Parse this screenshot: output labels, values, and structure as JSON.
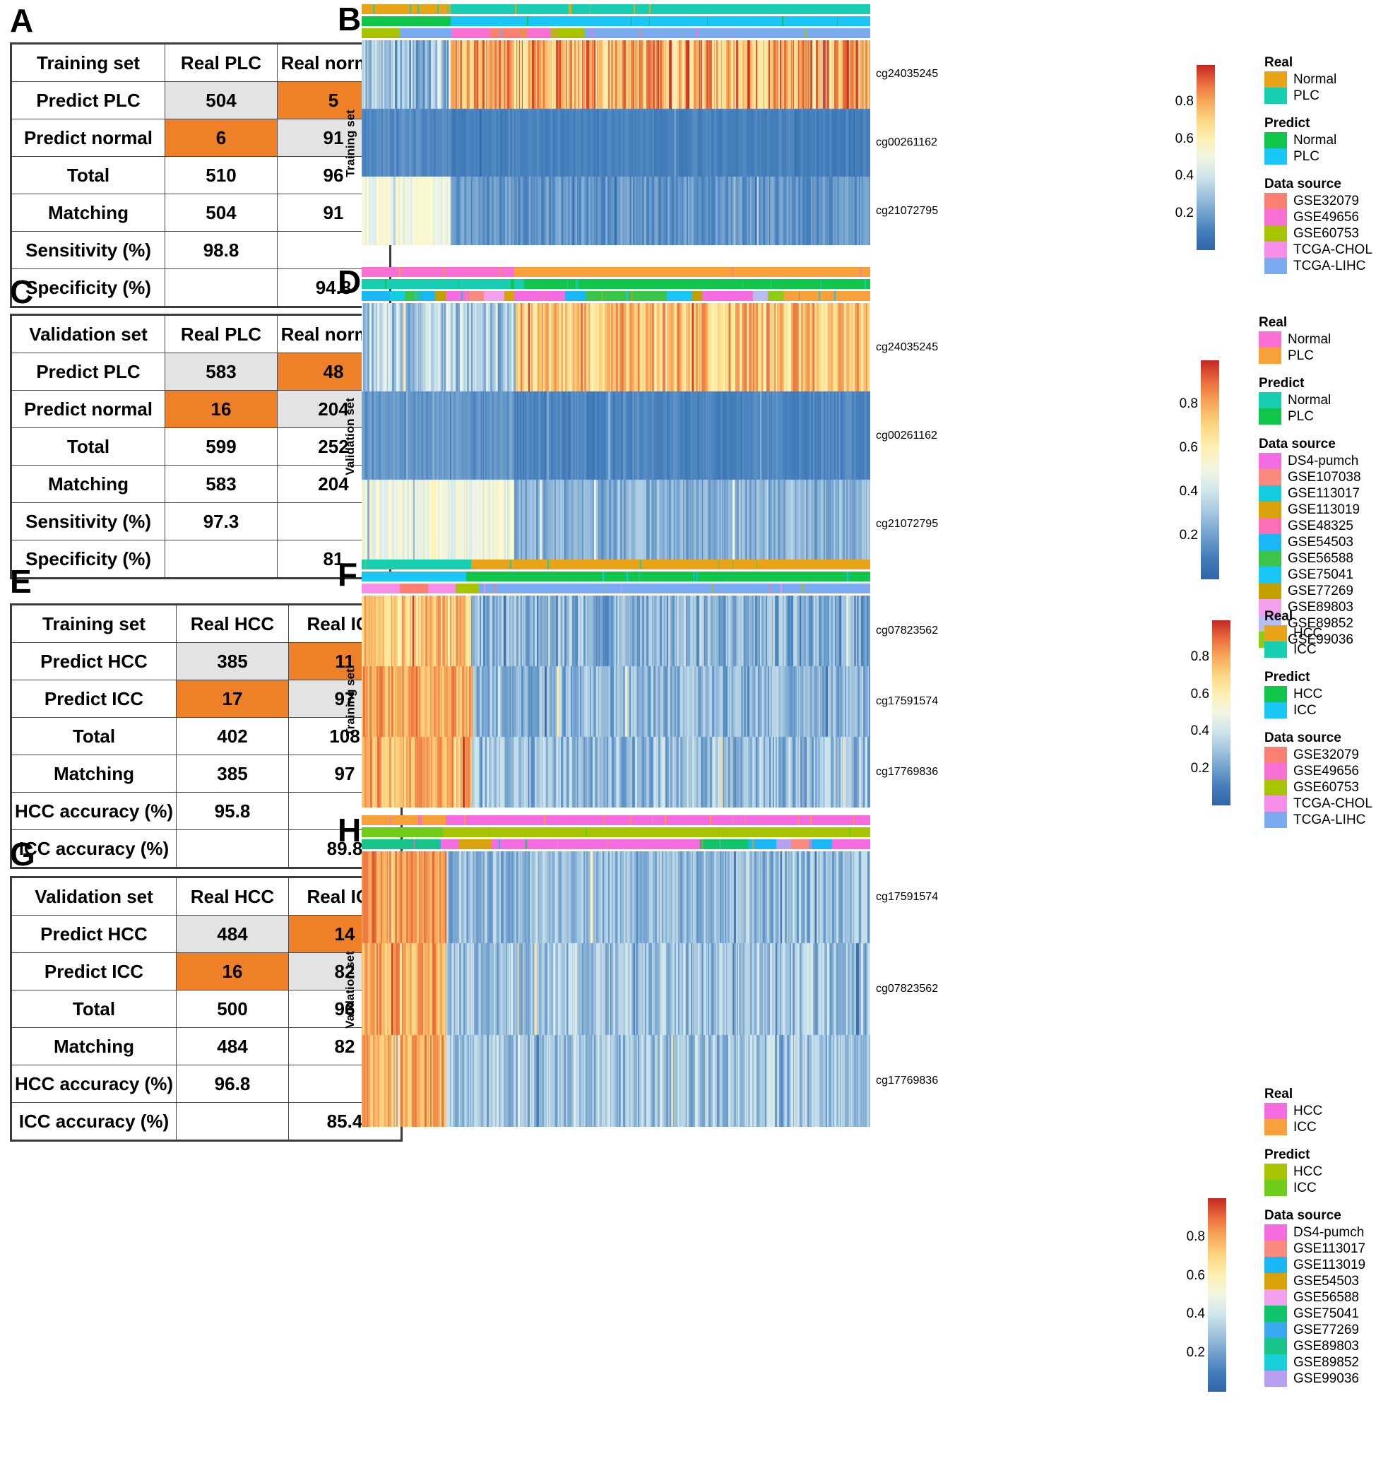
{
  "figure": {
    "panels": [
      "A",
      "B",
      "C",
      "D",
      "E",
      "F",
      "G",
      "H"
    ]
  },
  "palette": {
    "orange_cell": "#ee8027",
    "grey_cell": "#e3e3e3",
    "heat_high": "#cb2b1f",
    "heat_mid": "#fffacd",
    "heat_low": "#3a6fae"
  },
  "panelA": {
    "letter": "A",
    "headers": [
      "Training set",
      "Real PLC",
      "Real normal"
    ],
    "rows": [
      {
        "label": "Predict PLC",
        "c1": "504",
        "c2": "5",
        "c1style": "grey",
        "c2style": "orange"
      },
      {
        "label": "Predict normal",
        "c1": "6",
        "c2": "91",
        "c1style": "orange",
        "c2style": "grey"
      },
      {
        "label": "Total",
        "c1": "510",
        "c2": "96",
        "c1style": "plain",
        "c2style": "plain"
      },
      {
        "label": "Matching",
        "c1": "504",
        "c2": "91",
        "c1style": "plain",
        "c2style": "plain"
      },
      {
        "label": "Sensitivity (%)",
        "c1": "98.8",
        "c2": "",
        "c1style": "plain",
        "c2style": "plain"
      },
      {
        "label": "Specificity (%)",
        "c1": "",
        "c2": "94.8",
        "c1style": "plain",
        "c2style": "plain"
      }
    ]
  },
  "panelC": {
    "letter": "C",
    "headers": [
      "Validation set",
      "Real PLC",
      "Real normal"
    ],
    "rows": [
      {
        "label": "Predict PLC",
        "c1": "583",
        "c2": "48",
        "c1style": "grey",
        "c2style": "orange"
      },
      {
        "label": "Predict normal",
        "c1": "16",
        "c2": "204",
        "c1style": "orange",
        "c2style": "grey"
      },
      {
        "label": "Total",
        "c1": "599",
        "c2": "252",
        "c1style": "plain",
        "c2style": "plain"
      },
      {
        "label": "Matching",
        "c1": "583",
        "c2": "204",
        "c1style": "plain",
        "c2style": "plain"
      },
      {
        "label": "Sensitivity (%)",
        "c1": "97.3",
        "c2": "",
        "c1style": "plain",
        "c2style": "plain"
      },
      {
        "label": "Specificity (%)",
        "c1": "",
        "c2": "81",
        "c1style": "plain",
        "c2style": "plain"
      }
    ]
  },
  "panelE": {
    "letter": "E",
    "headers": [
      "Training set",
      "Real HCC",
      "Real ICC"
    ],
    "rows": [
      {
        "label": "Predict HCC",
        "c1": "385",
        "c2": "11",
        "c1style": "grey",
        "c2style": "orange"
      },
      {
        "label": "Predict ICC",
        "c1": "17",
        "c2": "97",
        "c1style": "orange",
        "c2style": "grey"
      },
      {
        "label": "Total",
        "c1": "402",
        "c2": "108",
        "c1style": "plain",
        "c2style": "plain"
      },
      {
        "label": "Matching",
        "c1": "385",
        "c2": "97",
        "c1style": "plain",
        "c2style": "plain"
      },
      {
        "label": "HCC accuracy (%)",
        "c1": "95.8",
        "c2": "",
        "c1style": "plain",
        "c2style": "plain"
      },
      {
        "label": "ICC accuracy (%)",
        "c1": "",
        "c2": "89.8",
        "c1style": "plain",
        "c2style": "plain"
      }
    ]
  },
  "panelG": {
    "letter": "G",
    "headers": [
      "Validation set",
      "Real HCC",
      "Real ICC"
    ],
    "rows": [
      {
        "label": "Predict HCC",
        "c1": "484",
        "c2": "14",
        "c1style": "grey",
        "c2style": "orange"
      },
      {
        "label": "Predict ICC",
        "c1": "16",
        "c2": "82",
        "c1style": "orange",
        "c2style": "grey"
      },
      {
        "label": "Total",
        "c1": "500",
        "c2": "96",
        "c1style": "plain",
        "c2style": "plain"
      },
      {
        "label": "Matching",
        "c1": "484",
        "c2": "82",
        "c1style": "plain",
        "c2style": "plain"
      },
      {
        "label": "HCC accuracy (%)",
        "c1": "96.8",
        "c2": "",
        "c1style": "plain",
        "c2style": "plain"
      },
      {
        "label": "ICC accuracy (%)",
        "c1": "",
        "c2": "85.4",
        "c1style": "plain",
        "c2style": "plain"
      }
    ]
  },
  "chart_data": [
    {
      "id": "panelB",
      "letter": "B",
      "type": "heatmap",
      "title": "",
      "ylabel": "Training set",
      "row_labels": [
        "cg24035245",
        "cg00261162",
        "cg21072795"
      ],
      "annotation_tracks": [
        {
          "name": "Real",
          "label": "Real"
        },
        {
          "name": "Predict",
          "label": "Predict"
        },
        {
          "name": "Data source",
          "label": "Data source"
        }
      ],
      "colorbar": {
        "ticks": [
          "0.8",
          "0.6",
          "0.4",
          "0.2"
        ],
        "values": [
          0.8,
          0.6,
          0.4,
          0.2
        ],
        "min": 0,
        "max": 1
      },
      "legends": [
        {
          "title": "Real",
          "items": [
            {
              "label": "Normal",
              "color": "#e8a317"
            },
            {
              "label": "PLC",
              "color": "#17cfb0"
            }
          ]
        },
        {
          "title": "Predict",
          "items": [
            {
              "label": "Normal",
              "color": "#0fc64a"
            },
            {
              "label": "PLC",
              "color": "#19c6f5"
            }
          ]
        },
        {
          "title": "Data source",
          "items": [
            {
              "label": "GSE32079",
              "color": "#fa8072"
            },
            {
              "label": "GSE49656",
              "color": "#fa6fd3"
            },
            {
              "label": "GSE60753",
              "color": "#a8c400"
            },
            {
              "label": "TCGA-CHOL",
              "color": "#f58fe8"
            },
            {
              "label": "TCGA-LIHC",
              "color": "#7aaaf0"
            }
          ]
        }
      ],
      "track_segments": {
        "Real": [
          [
            "#e8a317",
            0.175
          ],
          [
            "#17cfb0",
            0.825
          ]
        ],
        "Predict": [
          [
            "#0fc64a",
            0.175
          ],
          [
            "#19c6f5",
            0.825
          ]
        ],
        "Data source": [
          [
            "#a8c400",
            0.075
          ],
          [
            "#7aaaf0",
            0.102
          ],
          [
            "#fa6fd3",
            0.075
          ],
          [
            "#fa8072",
            0.075
          ],
          [
            "#fa6fd3",
            0.045
          ],
          [
            "#a8c400",
            0.065
          ],
          [
            "#7aaaf0",
            0.563
          ]
        ]
      },
      "row_profiles": [
        {
          "cpg": "cg24035245",
          "left_mean": 0.3,
          "right_mean": 0.78,
          "split": 0.175,
          "noise": 0.2
        },
        {
          "cpg": "cg00261162",
          "left_mean": 0.14,
          "right_mean": 0.11,
          "split": 0.175,
          "noise": 0.04
        },
        {
          "cpg": "cg21072795",
          "left_mean": 0.5,
          "right_mean": 0.17,
          "split": 0.175,
          "noise": 0.08
        }
      ]
    },
    {
      "id": "panelD",
      "letter": "D",
      "type": "heatmap",
      "title": "",
      "ylabel": "Validation set",
      "row_labels": [
        "cg24035245",
        "cg00261162",
        "cg21072795"
      ],
      "annotation_tracks": [
        {
          "name": "Real",
          "label": "Real"
        },
        {
          "name": "Predict",
          "label": "Predict"
        },
        {
          "name": "Data source",
          "label": "Data source"
        }
      ],
      "colorbar": {
        "ticks": [
          "0.8",
          "0.6",
          "0.4",
          "0.2"
        ],
        "values": [
          0.8,
          0.6,
          0.4,
          0.2
        ],
        "min": 0,
        "max": 1
      },
      "legends": [
        {
          "title": "Real",
          "items": [
            {
              "label": "Normal",
              "color": "#fa6fd3"
            },
            {
              "label": "PLC",
              "color": "#f8a03a"
            }
          ]
        },
        {
          "title": "Predict",
          "items": [
            {
              "label": "Normal",
              "color": "#17cfb0"
            },
            {
              "label": "PLC",
              "color": "#0fc64a"
            }
          ]
        },
        {
          "title": "Data source",
          "items": [
            {
              "label": "DS4-pumch",
              "color": "#f56ce0"
            },
            {
              "label": "GSE107038",
              "color": "#fa8a80"
            },
            {
              "label": "GSE113017",
              "color": "#14cde2"
            },
            {
              "label": "GSE113019",
              "color": "#d9a20a"
            },
            {
              "label": "GSE48325",
              "color": "#fa6fb5"
            },
            {
              "label": "GSE54503",
              "color": "#19b8f5"
            },
            {
              "label": "GSE56588",
              "color": "#3cc44a"
            },
            {
              "label": "GSE75041",
              "color": "#19c6f5"
            },
            {
              "label": "GSE77269",
              "color": "#c2a000"
            },
            {
              "label": "GSE89803",
              "color": "#f0a0ec"
            },
            {
              "label": "GSE89852",
              "color": "#b8bdf0"
            },
            {
              "label": "GSE99036",
              "color": "#8fcc18"
            }
          ]
        }
      ],
      "track_segments": {
        "Real": [
          [
            "#fa6fd3",
            0.3
          ],
          [
            "#f8a03a",
            0.7
          ]
        ],
        "Predict": [
          [
            "#17cfb0",
            0.295
          ],
          [
            "#0fc64a",
            0.005
          ],
          [
            "#17cfb0",
            0.02
          ],
          [
            "#0fc64a",
            0.68
          ]
        ],
        "Data source": [
          [
            "#19b8f5",
            0.055
          ],
          [
            "#14cde2",
            0.03
          ],
          [
            "#3cc44a",
            0.025
          ],
          [
            "#19b8f5",
            0.035
          ],
          [
            "#c2a000",
            0.02
          ],
          [
            "#f56ce0",
            0.04
          ],
          [
            "#fa8a80",
            0.035
          ],
          [
            "#f0a0ec",
            0.04
          ],
          [
            "#d9a20a",
            0.02
          ],
          [
            "#f56ce0",
            0.1
          ],
          [
            "#19b8f5",
            0.04
          ],
          [
            "#3cc44a",
            0.16
          ],
          [
            "#19c6f5",
            0.05
          ],
          [
            "#c2a000",
            0.02
          ],
          [
            "#f56ce0",
            0.1
          ],
          [
            "#b8bdf0",
            0.03
          ],
          [
            "#8fcc18",
            0.03
          ],
          [
            "#f8a03a",
            0.17
          ]
        ]
      },
      "row_profiles": [
        {
          "cpg": "cg24035245",
          "left_mean": 0.33,
          "right_mean": 0.74,
          "split": 0.3,
          "noise": 0.16
        },
        {
          "cpg": "cg00261162",
          "left_mean": 0.17,
          "right_mean": 0.12,
          "split": 0.3,
          "noise": 0.05
        },
        {
          "cpg": "cg21072795",
          "left_mean": 0.5,
          "right_mean": 0.25,
          "split": 0.3,
          "noise": 0.1
        }
      ]
    },
    {
      "id": "panelF",
      "letter": "F",
      "type": "heatmap",
      "title": "",
      "ylabel": "Training set",
      "row_labels": [
        "cg07823562",
        "cg17591574",
        "cg17769836"
      ],
      "annotation_tracks": [
        {
          "name": "Real",
          "label": "Real"
        },
        {
          "name": "Predict",
          "label": "Predict"
        },
        {
          "name": "Data source",
          "label": "Data source"
        }
      ],
      "colorbar": {
        "ticks": [
          "0.8",
          "0.6",
          "0.4",
          "0.2"
        ],
        "values": [
          0.8,
          0.6,
          0.4,
          0.2
        ],
        "min": 0,
        "max": 1
      },
      "legends": [
        {
          "title": "Real",
          "items": [
            {
              "label": "HCC",
              "color": "#e8a317"
            },
            {
              "label": "ICC",
              "color": "#17cfb0"
            }
          ]
        },
        {
          "title": "Predict",
          "items": [
            {
              "label": "HCC",
              "color": "#0fc64a"
            },
            {
              "label": "ICC",
              "color": "#19c6f5"
            }
          ]
        },
        {
          "title": "Data source",
          "items": [
            {
              "label": "GSE32079",
              "color": "#fa8072"
            },
            {
              "label": "GSE49656",
              "color": "#fa6fd3"
            },
            {
              "label": "GSE60753",
              "color": "#a8c400"
            },
            {
              "label": "TCGA-CHOL",
              "color": "#f58fe8"
            },
            {
              "label": "TCGA-LIHC",
              "color": "#7aaaf0"
            }
          ]
        }
      ],
      "track_segments": {
        "Real": [
          [
            "#17cfb0",
            0.215
          ],
          [
            "#e8a317",
            0.785
          ]
        ],
        "Predict": [
          [
            "#19c6f5",
            0.205
          ],
          [
            "#0fc64a",
            0.795
          ]
        ],
        "Data source": [
          [
            "#f58fe8",
            0.075
          ],
          [
            "#fa8072",
            0.055
          ],
          [
            "#f58fe8",
            0.055
          ],
          [
            "#a8c400",
            0.045
          ],
          [
            "#7aaaf0",
            0.77
          ]
        ]
      },
      "row_profiles": [
        {
          "cpg": "cg07823562",
          "left_mean": 0.72,
          "right_mean": 0.25,
          "split": 0.215,
          "noise": 0.14
        },
        {
          "cpg": "cg17591574",
          "left_mean": 0.8,
          "right_mean": 0.26,
          "split": 0.215,
          "noise": 0.12
        },
        {
          "cpg": "cg17769836",
          "left_mean": 0.78,
          "right_mean": 0.28,
          "split": 0.215,
          "noise": 0.14
        }
      ]
    },
    {
      "id": "panelH",
      "letter": "H",
      "type": "heatmap",
      "title": "",
      "ylabel": "Validation set",
      "row_labels": [
        "cg17591574",
        "cg07823562",
        "cg17769836"
      ],
      "annotation_tracks": [
        {
          "name": "Real",
          "label": "Real"
        },
        {
          "name": "Predict",
          "label": "Predict"
        },
        {
          "name": "Data source",
          "label": "Data source"
        }
      ],
      "colorbar": {
        "ticks": [
          "0.8",
          "0.6",
          "0.4",
          "0.2"
        ],
        "values": [
          0.8,
          0.6,
          0.4,
          0.2
        ],
        "min": 0,
        "max": 1
      },
      "legends": [
        {
          "title": "Real",
          "items": [
            {
              "label": "HCC",
              "color": "#f56ce0"
            },
            {
              "label": "ICC",
              "color": "#f8a03a"
            }
          ]
        },
        {
          "title": "Predict",
          "items": [
            {
              "label": "HCC",
              "color": "#a8c400"
            },
            {
              "label": "ICC",
              "color": "#6fcc18"
            }
          ]
        },
        {
          "title": "Data source",
          "items": [
            {
              "label": "DS4-pumch",
              "color": "#f56ce0"
            },
            {
              "label": "GSE113017",
              "color": "#fa8a80"
            },
            {
              "label": "GSE113019",
              "color": "#19b8f5"
            },
            {
              "label": "GSE54503",
              "color": "#d9a20a"
            },
            {
              "label": "GSE56588",
              "color": "#f0a0ec"
            },
            {
              "label": "GSE75041",
              "color": "#0fc46a"
            },
            {
              "label": "GSE77269",
              "color": "#3aa8f0"
            },
            {
              "label": "GSE89803",
              "color": "#17c48a"
            },
            {
              "label": "GSE89852",
              "color": "#17cfd8"
            },
            {
              "label": "GSE99036",
              "color": "#b8a0f0"
            }
          ]
        }
      ],
      "track_segments": {
        "Real": [
          [
            "#f8a03a",
            0.165
          ],
          [
            "#f56ce0",
            0.835
          ]
        ],
        "Predict": [
          [
            "#6fcc18",
            0.16
          ],
          [
            "#a8c400",
            0.84
          ]
        ],
        "Data source": [
          [
            "#17c48a",
            0.155
          ],
          [
            "#f56ce0",
            0.035
          ],
          [
            "#d9a20a",
            0.065
          ],
          [
            "#f56ce0",
            0.41
          ],
          [
            "#0fc46a",
            0.095
          ],
          [
            "#19b8f5",
            0.055
          ],
          [
            "#b8a0f0",
            0.03
          ],
          [
            "#fa8a80",
            0.035
          ],
          [
            "#19b8f5",
            0.045
          ],
          [
            "#f56ce0",
            0.075
          ]
        ]
      },
      "row_profiles": [
        {
          "cpg": "cg17591574",
          "left_mean": 0.82,
          "right_mean": 0.27,
          "split": 0.165,
          "noise": 0.12
        },
        {
          "cpg": "cg07823562",
          "left_mean": 0.78,
          "right_mean": 0.3,
          "split": 0.165,
          "noise": 0.14
        },
        {
          "cpg": "cg17769836",
          "left_mean": 0.8,
          "right_mean": 0.3,
          "split": 0.165,
          "noise": 0.14
        }
      ]
    }
  ]
}
